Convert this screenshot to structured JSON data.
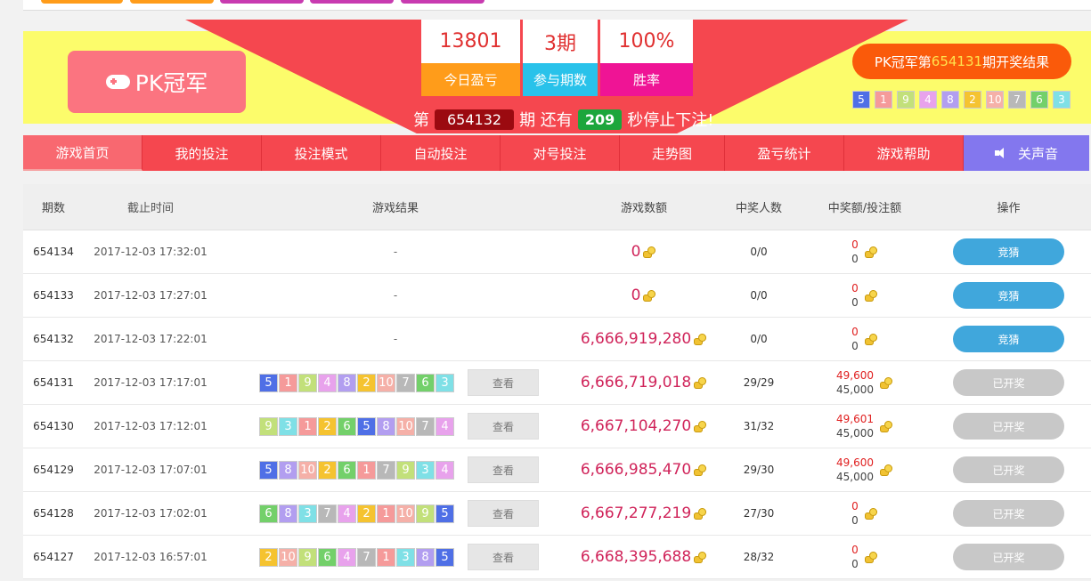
{
  "top_tabs": [
    {
      "color": "#ff9c1a"
    },
    {
      "color": "#ff9c1a"
    },
    {
      "color": "#c83bb0"
    },
    {
      "color": "#c83bb0"
    },
    {
      "color": "#c83bb0"
    }
  ],
  "logo": {
    "icon": "gamepad-icon",
    "title": "PK冠军"
  },
  "stats": [
    {
      "value": "13801",
      "label": "今日盈亏",
      "color": "#ff9c1a"
    },
    {
      "value": "3期",
      "label": "参与期数",
      "color": "#29c2ea"
    },
    {
      "value": "100%",
      "label": "胜率",
      "color": "#ef1495"
    }
  ],
  "countdown": {
    "prefix": "第",
    "issue": "654132",
    "mid": "期 还有",
    "seconds": "209",
    "suffix": "秒停止下注!"
  },
  "last_result": {
    "prefix": "PK冠军第",
    "issue": "654131",
    "suffix": "期开奖结果",
    "balls": [
      5,
      1,
      9,
      4,
      8,
      2,
      10,
      7,
      6,
      3
    ]
  },
  "ball_colors": {
    "1": "#f59a9a",
    "2": "#f5c330",
    "3": "#7fe0e6",
    "4": "#e8a2ec",
    "5": "#4f6fe6",
    "6": "#73d06a",
    "7": "#b8b8b8",
    "8": "#b29ef0",
    "9": "#c2e07a",
    "10": "#f5b0a8"
  },
  "nav": [
    {
      "label": "游戏首页",
      "active": true
    },
    {
      "label": "我的投注"
    },
    {
      "label": "投注模式"
    },
    {
      "label": "自动投注"
    },
    {
      "label": "对号投注"
    },
    {
      "label": "走势图"
    },
    {
      "label": "盈亏统计"
    },
    {
      "label": "游戏帮助"
    },
    {
      "label": "关声音",
      "icon": "speaker-icon"
    }
  ],
  "table": {
    "headers": {
      "issue": "期数",
      "time": "截止时间",
      "result": "游戏结果",
      "amount": "游戏数额",
      "winners": "中奖人数",
      "ratio": "中奖额/投注额",
      "op": "操作"
    },
    "view_label": "查看",
    "bet_label": "竞猜",
    "done_label": "已开奖",
    "rows": [
      {
        "issue": "654134",
        "time": "2017-12-03 17:32:01",
        "result": "-",
        "amount": "0",
        "winners": "0/0",
        "win_amount": "0",
        "bet_amount": "0",
        "status": "bet"
      },
      {
        "issue": "654133",
        "time": "2017-12-03 17:27:01",
        "result": "-",
        "amount": "0",
        "winners": "0/0",
        "win_amount": "0",
        "bet_amount": "0",
        "status": "bet"
      },
      {
        "issue": "654132",
        "time": "2017-12-03 17:22:01",
        "result": "-",
        "amount": "6,666,919,280",
        "winners": "0/0",
        "win_amount": "0",
        "bet_amount": "0",
        "status": "bet"
      },
      {
        "issue": "654131",
        "time": "2017-12-03 17:17:01",
        "balls": [
          5,
          1,
          9,
          4,
          8,
          2,
          10,
          7,
          6,
          3
        ],
        "amount": "6,666,719,018",
        "winners": "29/29",
        "win_amount": "49,600",
        "bet_amount": "45,000",
        "status": "done"
      },
      {
        "issue": "654130",
        "time": "2017-12-03 17:12:01",
        "balls": [
          9,
          3,
          1,
          2,
          6,
          5,
          8,
          10,
          7,
          4
        ],
        "amount": "6,667,104,270",
        "winners": "31/32",
        "win_amount": "49,601",
        "bet_amount": "45,000",
        "status": "done"
      },
      {
        "issue": "654129",
        "time": "2017-12-03 17:07:01",
        "balls": [
          5,
          8,
          10,
          2,
          6,
          1,
          7,
          9,
          3,
          4
        ],
        "amount": "6,666,985,470",
        "winners": "29/30",
        "win_amount": "49,600",
        "bet_amount": "45,000",
        "status": "done"
      },
      {
        "issue": "654128",
        "time": "2017-12-03 17:02:01",
        "balls": [
          6,
          8,
          3,
          7,
          4,
          2,
          1,
          10,
          9,
          5
        ],
        "amount": "6,667,277,219",
        "winners": "27/30",
        "win_amount": "0",
        "bet_amount": "0",
        "status": "done"
      },
      {
        "issue": "654127",
        "time": "2017-12-03 16:57:01",
        "balls": [
          2,
          10,
          9,
          6,
          4,
          7,
          1,
          3,
          8,
          5
        ],
        "amount": "6,668,395,688",
        "winners": "28/32",
        "win_amount": "0",
        "bet_amount": "0",
        "status": "done"
      }
    ]
  }
}
